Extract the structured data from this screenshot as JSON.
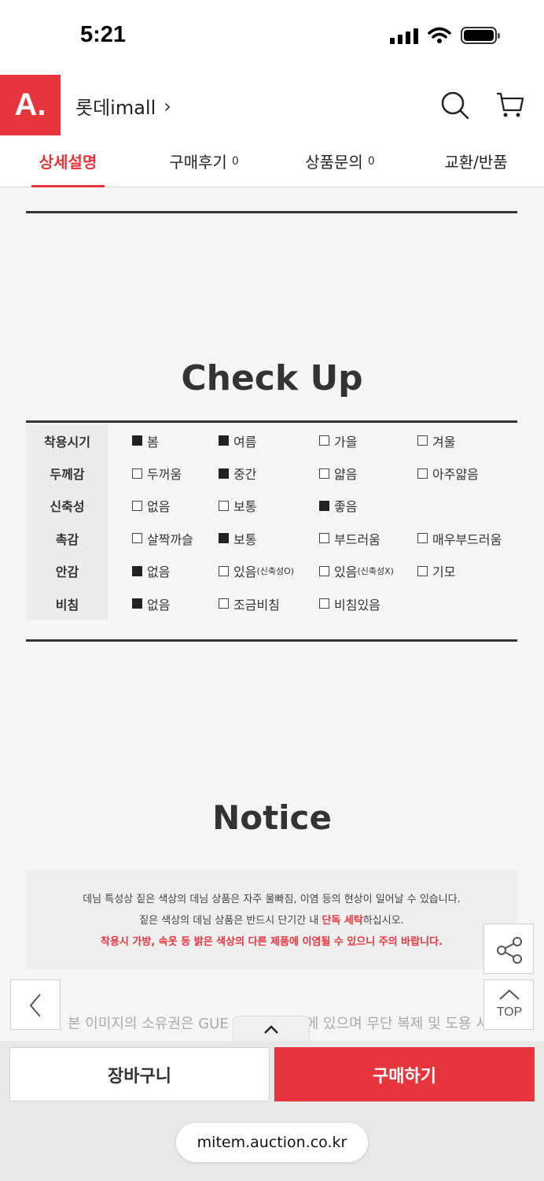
{
  "status": {
    "time": "5:21"
  },
  "header": {
    "logo_text": "A.",
    "mall_name": "롯데imall",
    "mall_chevron": "›"
  },
  "tabs": [
    {
      "label": "상세설명",
      "count": ""
    },
    {
      "label": "구매후기",
      "count": "0"
    },
    {
      "label": "상품문의",
      "count": "0"
    },
    {
      "label": "교환/반품",
      "count": ""
    }
  ],
  "checkup": {
    "title": "Check Up",
    "rows": [
      {
        "label": "착용시기",
        "options": [
          {
            "text": "봄",
            "checked": true
          },
          {
            "text": "여름",
            "checked": true
          },
          {
            "text": "가을",
            "checked": false
          },
          {
            "text": "겨울",
            "checked": false
          }
        ]
      },
      {
        "label": "두께감",
        "options": [
          {
            "text": "두꺼움",
            "checked": false
          },
          {
            "text": "중간",
            "checked": true
          },
          {
            "text": "얇음",
            "checked": false
          },
          {
            "text": "아주얇음",
            "checked": false
          }
        ]
      },
      {
        "label": "신축성",
        "options": [
          {
            "text": "없음",
            "checked": false
          },
          {
            "text": "보통",
            "checked": false
          },
          {
            "text": "좋음",
            "checked": true
          }
        ]
      },
      {
        "label": "촉감",
        "options": [
          {
            "text": "살짝까슬",
            "checked": false
          },
          {
            "text": "보통",
            "checked": true
          },
          {
            "text": "부드러움",
            "checked": false
          },
          {
            "text": "매우부드러움",
            "checked": false
          }
        ]
      },
      {
        "label": "안감",
        "options": [
          {
            "text": "없음",
            "checked": true
          },
          {
            "text": "있음",
            "note": "(신축성O)",
            "checked": false
          },
          {
            "text": "있음",
            "note": "(신축성X)",
            "checked": false
          },
          {
            "text": "기모",
            "checked": false
          }
        ]
      },
      {
        "label": "비침",
        "options": [
          {
            "text": "없음",
            "checked": true
          },
          {
            "text": "조금비침",
            "checked": false
          },
          {
            "text": "비침있음",
            "checked": false
          }
        ]
      }
    ]
  },
  "notice": {
    "title": "Notice",
    "line1": "데님 특성상 짙은 색상의 데님 상품은 자주 물빠짐, 이염 등의 현상이 일어날 수 있습니다.",
    "line2_pre": "짙은 색상의 데님 상품은 반드시 단기간 내 ",
    "line2_red": "단독 세탁",
    "line2_post": "하십시오.",
    "line3": "착용시 가방, 속옷 등 밝은 색상의 다른 제품에 이염될 수 있으니 주의 바랍니다."
  },
  "copyright": "본 이미지의 소유권은 GUE",
  "copyright_tail": "에 있으며 무단 복제 및 도용 시",
  "top_label": "TOP",
  "bottom": {
    "cart_label": "장바구니",
    "buy_label": "구매하기",
    "url": "mitem.auction.co.kr"
  }
}
